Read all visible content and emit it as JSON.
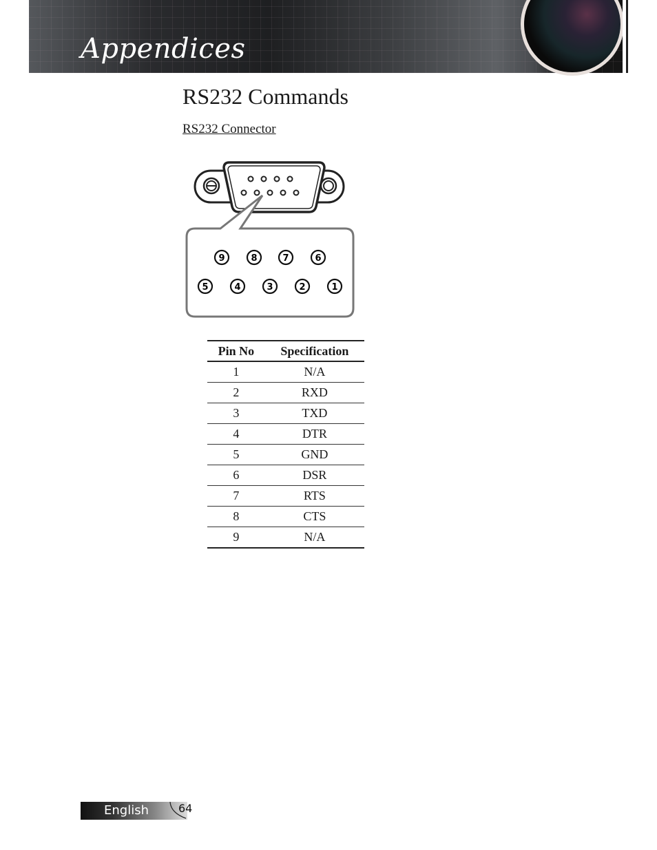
{
  "header": {
    "section_title": "Appendices"
  },
  "page": {
    "title": "RS232 Commands",
    "subheading": "RS232 Connector"
  },
  "connector": {
    "top_row_pins": [
      "9",
      "8",
      "7",
      "6"
    ],
    "bottom_row_pins": [
      "5",
      "4",
      "3",
      "2",
      "1"
    ]
  },
  "pin_table": {
    "headers": [
      "Pin No",
      "Specification"
    ],
    "rows": [
      [
        "1",
        "N/A"
      ],
      [
        "2",
        "RXD"
      ],
      [
        "3",
        "TXD"
      ],
      [
        "4",
        "DTR"
      ],
      [
        "5",
        "GND"
      ],
      [
        "6",
        "DSR"
      ],
      [
        "7",
        "RTS"
      ],
      [
        "8",
        "CTS"
      ],
      [
        "9",
        "N/A"
      ]
    ]
  },
  "footer": {
    "language": "English",
    "page_number": "64"
  }
}
